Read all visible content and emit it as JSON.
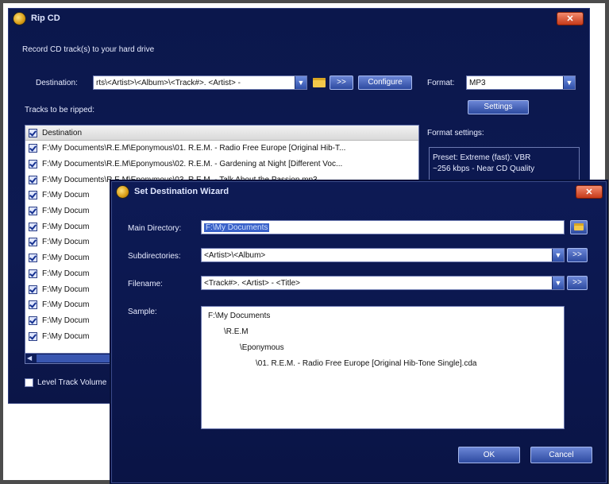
{
  "rip_window": {
    "title": "Rip CD",
    "close_label": "✕",
    "instruction": "Record CD track(s) to your hard drive",
    "destination_label": "Destination:",
    "destination_value": "rts\\<Artist>\\<Album>\\<Track#>. <Artist> -",
    "more_label": ">>",
    "configure_label": "Configure",
    "format_label": "Format:",
    "format_value": "MP3",
    "settings_label": "Settings",
    "format_settings_label": "Format settings:",
    "format_settings_line1": "Preset: Extreme (fast): VBR",
    "format_settings_line2": "~256 kbps - Near CD Quality",
    "tracks_label": "Tracks to be ripped:",
    "tracks_header": "Destination",
    "tracks": [
      "F:\\My Documents\\R.E.M\\Eponymous\\01. R.E.M. - Radio Free Europe [Original Hib-T...",
      "F:\\My Documents\\R.E.M\\Eponymous\\02. R.E.M. - Gardening at Night [Different Voc...",
      "F:\\My Documents\\R.E.M\\Eponymous\\03. R.E.M. - Talk About the Passion.mp3",
      "F:\\My Docum",
      "F:\\My Docum",
      "F:\\My Docum",
      "F:\\My Docum",
      "F:\\My Docum",
      "F:\\My Docum",
      "F:\\My Docum",
      "F:\\My Docum",
      "F:\\My Docum",
      "F:\\My Docum"
    ],
    "level_label": "Level Track Volume"
  },
  "wizard": {
    "title": "Set Destination Wizard",
    "close_label": "✕",
    "main_dir_label": "Main Directory:",
    "main_dir_value": "F:\\My Documents",
    "subdir_label": "Subdirectories:",
    "subdir_value": "<Artist>\\<Album>",
    "filename_label": "Filename:",
    "filename_value": "<Track#>. <Artist> - <Title>",
    "more_label": ">>",
    "sample_label": "Sample:",
    "sample_lines": [
      "F:\\My Documents",
      "\\R.E.M",
      "\\Eponymous",
      "\\01. R.E.M. - Radio Free Europe [Original Hib-Tone Single].cda"
    ],
    "ok_label": "OK",
    "cancel_label": "Cancel"
  }
}
